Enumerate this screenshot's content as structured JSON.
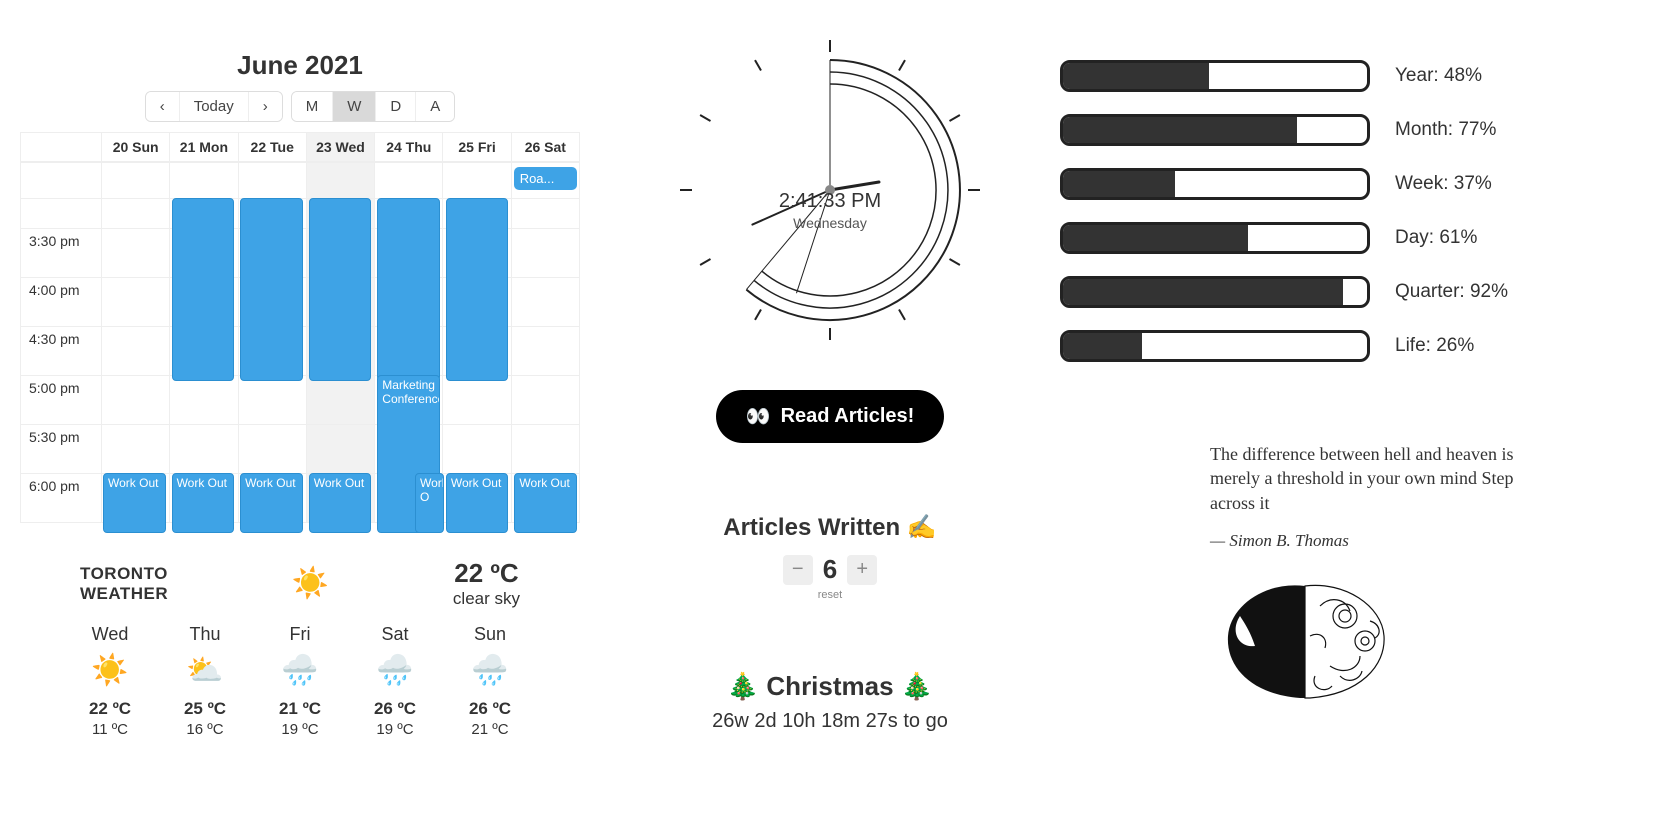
{
  "calendar": {
    "title": "June 2021",
    "nav": {
      "prev": "‹",
      "today": "Today",
      "next": "›"
    },
    "views": [
      "M",
      "W",
      "D",
      "A"
    ],
    "active_view": "W",
    "days": [
      "20 Sun",
      "21 Mon",
      "22 Tue",
      "23 Wed",
      "24 Thu",
      "25 Fri",
      "26 Sat"
    ],
    "today_index": 3,
    "allday": {
      "day_index": 6,
      "label": "Roa..."
    },
    "time_slots": [
      "3:30 pm",
      "4:00 pm",
      "4:30 pm",
      "5:00 pm",
      "5:30 pm",
      "6:00 pm"
    ],
    "events": {
      "block_cols": [
        1,
        2,
        3,
        4,
        5
      ],
      "marketing": {
        "label": "Marketing Conference",
        "day_index": 4
      },
      "workout_label": "Work Out",
      "wk_short": "Work O"
    }
  },
  "weather": {
    "location_line1": "TORONTO",
    "location_line2": "WEATHER",
    "current_temp": "22 ºC",
    "current_cond": "clear sky",
    "days": [
      {
        "label": "Wed",
        "icon": "sun",
        "hi": "22 ºC",
        "lo": "11 ºC"
      },
      {
        "label": "Thu",
        "icon": "partly",
        "hi": "25 ºC",
        "lo": "16 ºC"
      },
      {
        "label": "Fri",
        "icon": "rain",
        "hi": "21 ºC",
        "lo": "19 ºC"
      },
      {
        "label": "Sat",
        "icon": "rain",
        "hi": "26 ºC",
        "lo": "19 ºC"
      },
      {
        "label": "Sun",
        "icon": "rain",
        "hi": "26 ºC",
        "lo": "21 ºC"
      }
    ]
  },
  "clock": {
    "time": "2:41:33 PM",
    "day": "Wednesday"
  },
  "read_button": {
    "icon": "👀",
    "label": "Read Articles!"
  },
  "counter": {
    "title": "Articles Written ✍️",
    "value": "6",
    "reset_label": "reset"
  },
  "countdown": {
    "title": "🎄 Christmas 🎄",
    "remaining": "26w 2d 10h 18m 27s to go"
  },
  "progress": [
    {
      "label": "Year: 48%",
      "pct": 48
    },
    {
      "label": "Month: 77%",
      "pct": 77
    },
    {
      "label": "Week: 37%",
      "pct": 37
    },
    {
      "label": "Day: 61%",
      "pct": 61
    },
    {
      "label": "Quarter: 92%",
      "pct": 92
    },
    {
      "label": "Life: 26%",
      "pct": 26
    }
  ],
  "quote": {
    "text": "The difference between hell and heaven is merely a threshold in your own mind Step across it",
    "author": "— Simon B. Thomas"
  }
}
